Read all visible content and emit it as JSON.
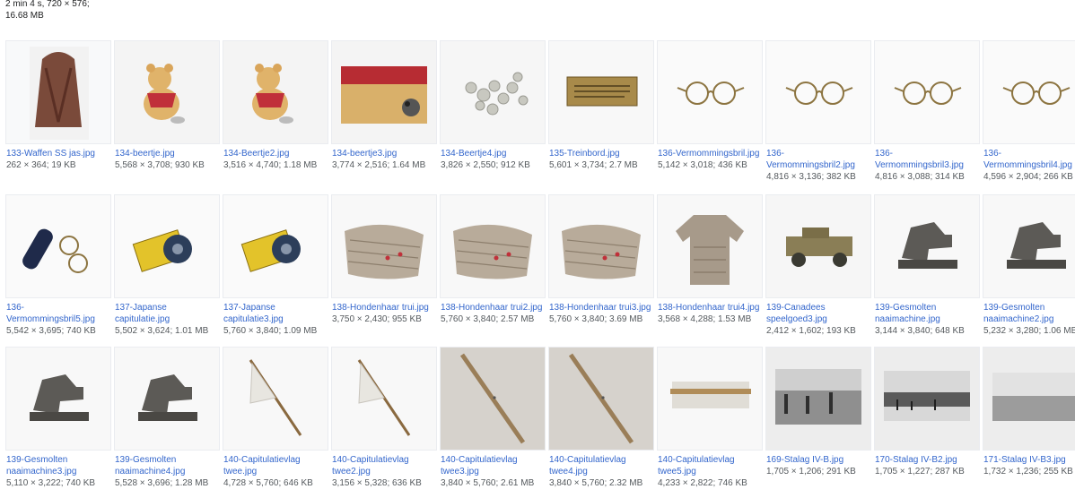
{
  "header": {
    "line1": "2 min 4 s, 720 × 576;",
    "line2": "16.68 MB"
  },
  "rows": [
    [
      {
        "name": "133-Waffen SS jas.jpg",
        "meta": "262 × 364; 19 KB",
        "icon": "coat"
      },
      {
        "name": "134-beertje.jpg",
        "meta": "5,568 × 3,708; 930 KB",
        "icon": "teddy-bear"
      },
      {
        "name": "134-Beertje2.jpg",
        "meta": "3,516 × 4,740; 1.18 MB",
        "icon": "teddy-bear"
      },
      {
        "name": "134-beertje3.jpg",
        "meta": "3,774 × 2,516; 1.64 MB",
        "icon": "teddy-bear-closeup"
      },
      {
        "name": "134-Beertje4.jpg",
        "meta": "3,826 × 2,550; 912 KB",
        "icon": "coins"
      },
      {
        "name": "135-Treinbord.jpg",
        "meta": "5,601 × 3,734; 2.7 MB",
        "icon": "plaque"
      },
      {
        "name": "136-Vermommingsbril.jpg",
        "meta": "5,142 × 3,018; 436 KB",
        "icon": "glasses"
      },
      {
        "name": "136-Vermommingsbril2.jpg",
        "meta": "4,816 × 3,136; 382 KB",
        "icon": "glasses"
      },
      {
        "name": "136-Vermommingsbril3.jpg",
        "meta": "4,816 × 3,088; 314 KB",
        "icon": "glasses"
      },
      {
        "name": "136-Vermommingsbril4.jpg",
        "meta": "4,596 × 2,904; 266 KB",
        "icon": "glasses"
      }
    ],
    [
      {
        "name": "136-Vermommingsbril5.jpg",
        "meta": "5,542 × 3,695; 740 KB",
        "icon": "glasses-case"
      },
      {
        "name": "137-Japanse capitulatie.jpg",
        "meta": "5,502 × 3,624; 1.01 MB",
        "icon": "film-tin"
      },
      {
        "name": "137-Japanse capitulatie3.jpg",
        "meta": "5,760 × 3,840; 1.09 MB",
        "icon": "film-tin"
      },
      {
        "name": "138-Hondenhaar trui.jpg",
        "meta": "3,750 × 2,430; 955 KB",
        "icon": "knitted-sweater"
      },
      {
        "name": "138-Hondenhaar trui2.jpg",
        "meta": "5,760 × 3,840; 2.57 MB",
        "icon": "knitted-sweater"
      },
      {
        "name": "138-Hondenhaar trui3.jpg",
        "meta": "5,760 × 3,840; 3.69 MB",
        "icon": "knitted-sweater"
      },
      {
        "name": "138-Hondenhaar trui4.jpg",
        "meta": "3,568 × 4,288; 1.53 MB",
        "icon": "sweater"
      },
      {
        "name": "139-Canadees speelgoed3.jpg",
        "meta": "2,412 × 1,602; 193 KB",
        "icon": "toy-jeep"
      },
      {
        "name": "139-Gesmolten naaimachine.jpg",
        "meta": "3,144 × 3,840; 648 KB",
        "icon": "sewing-machine"
      },
      {
        "name": "139-Gesmolten naaimachine2.jpg",
        "meta": "5,232 × 3,280; 1.06 MB",
        "icon": "sewing-machine"
      }
    ],
    [
      {
        "name": "139-Gesmolten naaimachine3.jpg",
        "meta": "5,110 × 3,222; 740 KB",
        "icon": "sewing-machine"
      },
      {
        "name": "139-Gesmolten naaimachine4.jpg",
        "meta": "5,528 × 3,696; 1.28 MB",
        "icon": "sewing-machine"
      },
      {
        "name": "140-Capitulatievlag twee.jpg",
        "meta": "4,728 × 5,760; 646 KB",
        "icon": "white-flag"
      },
      {
        "name": "140-Capitulatievlag twee2.jpg",
        "meta": "3,156 × 5,328; 636 KB",
        "icon": "white-flag"
      },
      {
        "name": "140-Capitulatievlag twee3.jpg",
        "meta": "3,840 × 5,760; 2.61 MB",
        "icon": "flag-closeup"
      },
      {
        "name": "140-Capitulatievlag twee4.jpg",
        "meta": "3,840 × 5,760; 2.32 MB",
        "icon": "flag-closeup"
      },
      {
        "name": "140-Capitulatievlag twee5.jpg",
        "meta": "4,233 × 2,822; 746 KB",
        "icon": "flag-pole"
      },
      {
        "name": "169-Stalag IV-B.jpg",
        "meta": "1,705 × 1,206; 291 KB",
        "icon": "photo-barracks"
      },
      {
        "name": "170-Stalag IV-B2.jpg",
        "meta": "1,705 × 1,227; 287 KB",
        "icon": "photo-camp"
      },
      {
        "name": "171-Stalag IV-B3.jpg",
        "meta": "1,732 × 1,236; 255 KB",
        "icon": "photo-field"
      }
    ]
  ]
}
